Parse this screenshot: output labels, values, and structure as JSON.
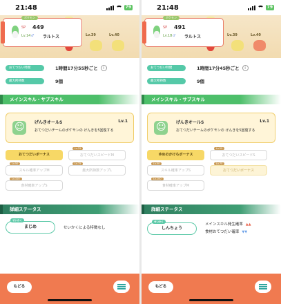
{
  "screens": [
    {
      "status": {
        "time": "21:48",
        "battery": "79"
      },
      "banner": {
        "tag": "ポケモン",
        "sp": "449",
        "sp_label": "SP",
        "level": "Lv.14",
        "gender": "♂",
        "name": "ラルトス",
        "others": [
          {
            "level": "Lv.39"
          },
          {
            "level": "Lv.40"
          }
        ]
      },
      "info": {
        "help_label": "おてつだい時間",
        "help_value": "1時間17分55秒ごと",
        "carry_label": "最大所持数",
        "carry_value": "9個"
      },
      "skills_header": "メインスキル・サブスキル",
      "main_skill": {
        "name": "げんきオールS",
        "level": "Lv.1",
        "desc": "おてつだいチームのポケモンの げんきを5回復する"
      },
      "subskills": [
        {
          "lv": "",
          "label": "おてつだいボーナス",
          "style": "gold"
        },
        {
          "lv": "Lv.25",
          "label": "おてつだいスピードM",
          "style": "off"
        },
        {
          "lv": "Lv.50",
          "label": "スキル確率アップM",
          "style": "off"
        },
        {
          "lv": "Lv.75",
          "label": "最大所持数アップL",
          "style": "off"
        },
        {
          "lv": "Lv.100",
          "label": "食材確率アップS",
          "style": "off"
        }
      ],
      "nature_header": "詳細ステータス",
      "nature": {
        "tag": "せいかく",
        "name": "まじめ",
        "effect": "せいかくによる特徴なし"
      },
      "bottom": {
        "back": "もどる"
      }
    },
    {
      "status": {
        "time": "21:48",
        "battery": "79"
      },
      "banner": {
        "tag": "ポケモン",
        "sp": "491",
        "sp_label": "SP",
        "level": "Lv.18",
        "gender": "♂",
        "name": "ラルトス",
        "others": [
          {
            "level": "Lv.39"
          },
          {
            "level": "Lv.40"
          }
        ]
      },
      "info": {
        "help_label": "おてつだい時間",
        "help_value": "1時間17分45秒ごと",
        "carry_label": "最大所持数",
        "carry_value": "9個"
      },
      "skills_header": "メインスキル・サブスキル",
      "main_skill": {
        "name": "げんきオールS",
        "level": "Lv.1",
        "desc": "おてつだいチームのポケモンの げんきを5回復する"
      },
      "subskills": [
        {
          "lv": "",
          "label": "ゆめのかけらボーナス",
          "style": "gold"
        },
        {
          "lv": "Lv.25",
          "label": "おてつだいスピードS",
          "style": "off"
        },
        {
          "lv": "Lv.50",
          "label": "スキル確率アップS",
          "style": "off"
        },
        {
          "lv": "Lv.75",
          "label": "おてつだいボーナス",
          "style": "cream"
        },
        {
          "lv": "Lv.100",
          "label": "食材確率アップM",
          "style": "off"
        }
      ],
      "nature_header": "詳細ステータス",
      "nature": {
        "tag": "せいかく",
        "name": "しんちょう",
        "effects": [
          {
            "label": "メインスキル発生確率",
            "arrows": "▲▲",
            "dir": "up"
          },
          {
            "label": "食材おてつだい確率",
            "arrows": "▼▼",
            "dir": "down"
          }
        ]
      },
      "bottom": {
        "back": "もどる"
      }
    }
  ]
}
